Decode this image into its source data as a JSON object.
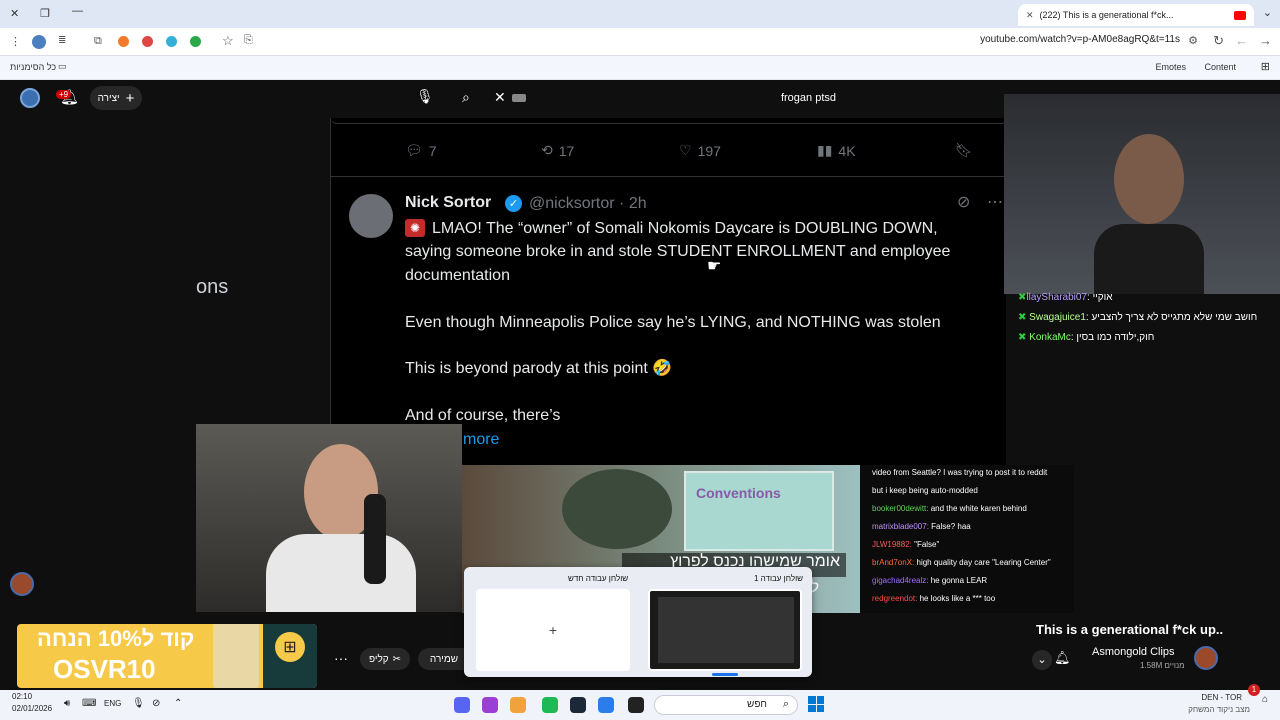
{
  "browser": {
    "tab_title": "(222) This is a generational f*ck...",
    "url": "youtube.com/watch?v=p-AM0e8agRQ&t=11s",
    "bookmarks_all": "כל הסימניות",
    "bookmark_emotes": "Emotes",
    "bookmark_content": "Content"
  },
  "youtube": {
    "create_label": "יצירה",
    "notif_badge": "+9",
    "search_value": "frogan ptsd"
  },
  "tweet": {
    "prev_metrics": {
      "replies": "7",
      "retweets": "17",
      "likes": "197",
      "views": "4K"
    },
    "author": "Nick Sortor",
    "handle": "@nicksortor · 2h",
    "line1": "LMAO! The “owner” of Somali Nokomis Daycare is DOUBLING DOWN,",
    "line2": "saying someone broke in and stole STUDENT ENROLLMENT and employee",
    "line3": "documentation",
    "line4": "Even though Minneapolis Police say he’s LYING, and NOTHING was stolen",
    "line5": "This is beyond parody at this point 🤣",
    "line6": "And of course, there’s",
    "show_more": "more"
  },
  "left_fragment": "ons",
  "chat_top": [
    {
      "user": "llaySharabi07",
      "msg": ": אוקיי"
    },
    {
      "user": "Swagajuice1",
      "msg": ": חושב שמי שלא מתגייס לא צריך להצביע"
    },
    {
      "user": "KonkaMc",
      "msg": ": חוק,ילודה כמו בסין"
    }
  ],
  "chat_bottom": [
    {
      "user": "",
      "msg": "video from Seattle? I was trying to post it to reddit",
      "color": "#ffffff"
    },
    {
      "user": "",
      "msg": "but i keep being auto-modded",
      "color": "#ffffff"
    },
    {
      "user": "booker00dewitt:",
      "msg": " and the white karen behind",
      "color": "#5fd35f"
    },
    {
      "user": "matrixblade007:",
      "msg": " False? haa",
      "color": "#c090ff"
    },
    {
      "user": "JLW19882:",
      "msg": " \"False\"",
      "color": "#ff5a5a"
    },
    {
      "user": "brAnd7onX:",
      "msg": " high quality day care \"Learing Center\"",
      "color": "#ff6a3a"
    },
    {
      "user": "gigachad4realz:",
      "msg": " he gonna LEAR",
      "color": "#a070ff"
    },
    {
      "user": "redgreendot:",
      "msg": " he looks like a *** too",
      "color": "#ff4a4a"
    }
  ],
  "clip": {
    "sign_text": "Conventions",
    "subtitle1": "אומר שמישהו נכנס לפרוץ",
    "subtitle2": "לעק"
  },
  "snap": {
    "new_desktop": "שולחן עבודה חדש",
    "desktop1": "שולחן עבודה 1",
    "plus": "+"
  },
  "video": {
    "title": "This is a generational f*ck up..",
    "channel": "Asmongold Clips",
    "subs": "1.58M מנויים",
    "save_label": "שמירה",
    "clip_label": "קליפ",
    "more": "···"
  },
  "ad": {
    "line1": "קוד ל10% הנחה",
    "line2": "OSVR10"
  },
  "taskbar": {
    "time": "02:10",
    "date": "02/01/2026",
    "lang": "ENG",
    "search": "חפש",
    "score": "DEN - TOR",
    "score_sub": "מצב ניקוד המשחק",
    "badge": "1"
  },
  "colors": {
    "twitter_blue": "#1d9bf0",
    "chat_green": "#2ecc40",
    "yt_red": "#ff0000",
    "ad_yellow": "#f7c948"
  }
}
